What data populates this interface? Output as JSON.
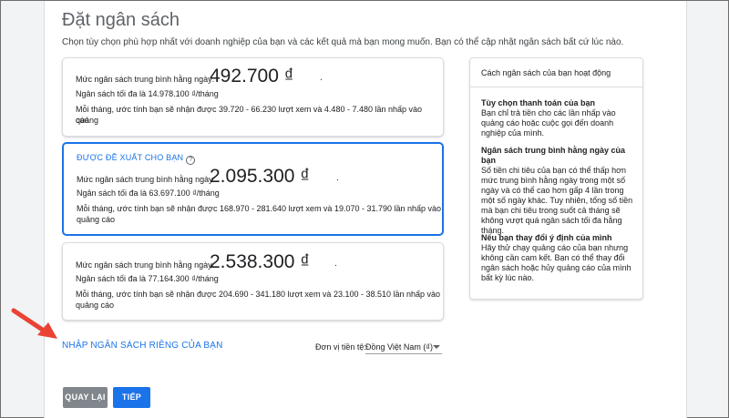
{
  "page": {
    "title": "Đặt ngân sách",
    "subtitle": "Chọn tùy chọn phù hợp nhất với doanh nghiệp của bạn và các kết quả mà bạn mong muốn. Bạn có thể cập nhật ngân sách bất cứ lúc nào."
  },
  "options": [
    {
      "badge": "",
      "daily_label": "Mức ngân sách trung bình hằng ngày:",
      "amount": "492.700 ₫",
      "dot": ".",
      "monthly_max": "Ngân sách tối đa là 14.978.100 ₫/tháng",
      "estimate_1": "Mỗi tháng, ước tính bạn sẽ nhận được 39.720 - 66.230 lượt xem và 4.480 - 7.480 lần nhấp vào quảng",
      "estimate_2": "cáo"
    },
    {
      "badge": "ĐƯỢC ĐỀ XUẤT CHO BẠN",
      "help": "?",
      "daily_label": "Mức ngân sách trung bình hằng ngày:",
      "amount": "2.095.300 ₫",
      "dot": ".",
      "monthly_max": "Ngân sách tối đa là 63.697.100 ₫/tháng",
      "estimate_1": "Mỗi tháng, ước tính bạn sẽ nhận được 168.970 - 281.640 lượt xem và 19.070 - 31.790 lần nhấp vào",
      "estimate_2": "quảng cáo"
    },
    {
      "badge": "",
      "daily_label": "Mức ngân sách trung bình hằng ngày:",
      "amount": "2.538.300 ₫",
      "dot": ".",
      "monthly_max": "Ngân sách tối đa là 77.164.300 ₫/tháng",
      "estimate_1": "Mỗi tháng, ước tính bạn sẽ nhận được 204.690 - 341.180 lượt xem và 23.100 - 38.510 lần nhấp vào",
      "estimate_2": "quảng cáo"
    }
  ],
  "info": {
    "title": "Cách ngân sách của bạn hoạt động",
    "sections": [
      {
        "heading": "Tùy chọn thanh toán của bạn",
        "lines": [
          "Bạn chỉ trả tiền cho các lần nhấp vào",
          "quảng cáo hoặc cuộc gọi đến doanh",
          "nghiệp của mình."
        ]
      },
      {
        "heading": "Ngân sách trung bình hằng ngày của bạn",
        "lines": [
          "Số tiền chi tiêu của bạn có thể thấp hơn",
          "mức trung bình hằng ngày trong một số",
          "ngày và có thể cao hơn gấp 4 lần trong",
          "một số ngày khác. Tuy nhiên, tổng số tiền",
          "mà bạn chi tiêu trong suốt cả tháng sẽ",
          "không vượt quá ngân sách tối đa hằng",
          "tháng."
        ]
      },
      {
        "heading": "Nếu bạn thay đổi ý định của mình",
        "lines": [
          "Hãy thử chạy quảng cáo của bạn nhưng",
          "không cần cam kết. Bạn có thể thay đổi",
          "ngân sách hoặc hủy quảng cáo của mình",
          "bất kỳ lúc nào."
        ]
      }
    ]
  },
  "custom_link": "NHẬP NGÂN SÁCH RIÊNG CỦA BẠN",
  "currency": {
    "label": "Đơn vị tiền tệ:",
    "value": "Đồng Việt Nam (₫)"
  },
  "buttons": {
    "back": "QUAY LẠI",
    "next": "TIẾP"
  },
  "colors": {
    "accent": "#1a73e8",
    "arrow": "#ea4335",
    "back_button": "#80868b"
  }
}
